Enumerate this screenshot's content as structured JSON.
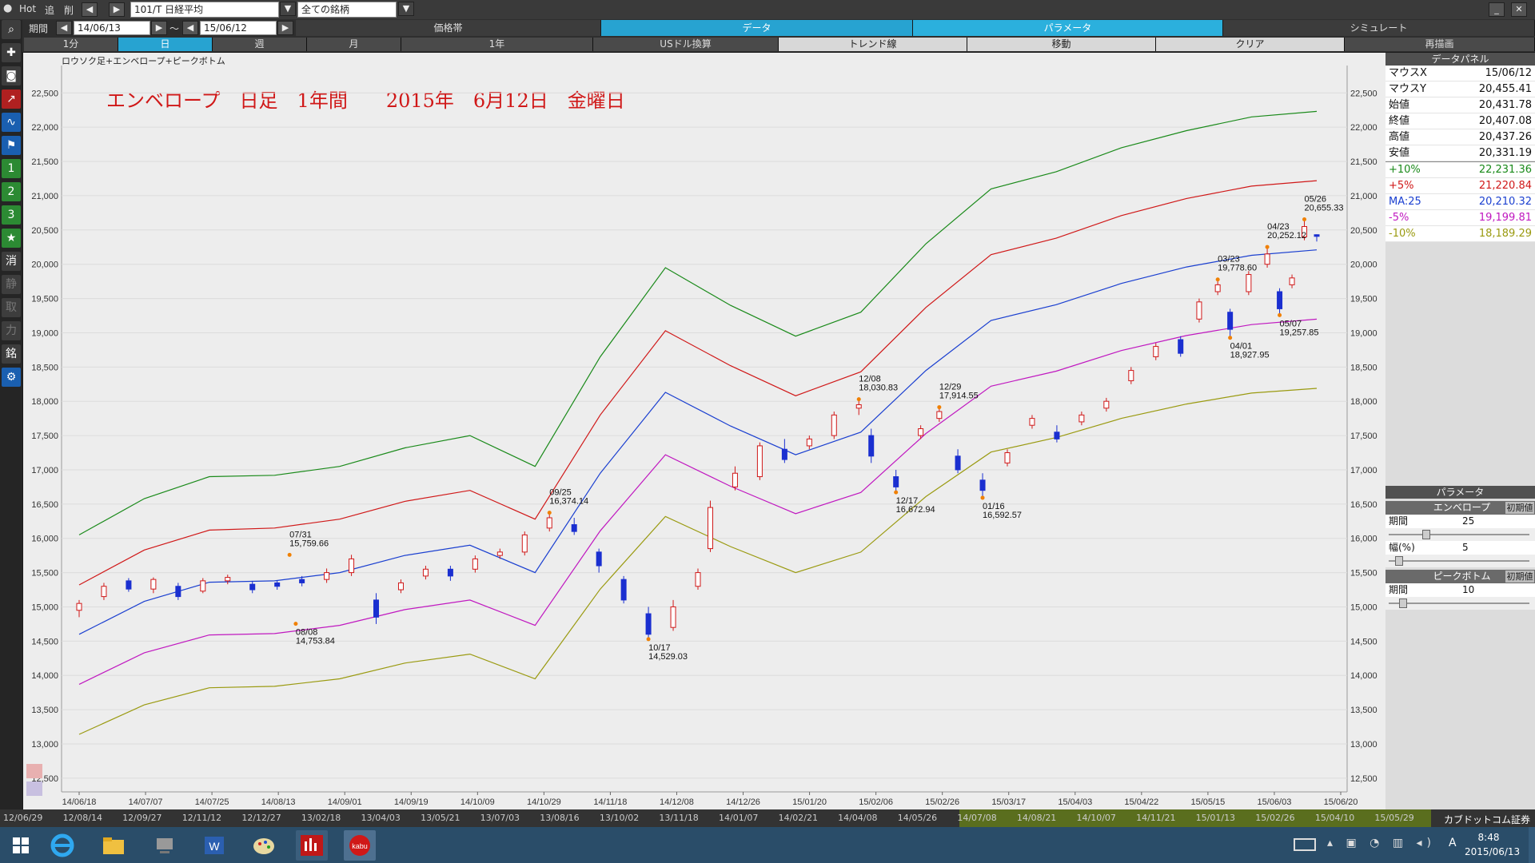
{
  "toolbar": {
    "hot": "Hot",
    "add": "追",
    "del": "削",
    "symbol": "101/T 日経平均",
    "market": "全ての銘柄",
    "period_label": "期間",
    "date_from": "14/06/13",
    "tilde": "～",
    "date_to": "15/06/12",
    "tabs": [
      "価格帯",
      "データ",
      "パラメータ",
      "シミュレート"
    ],
    "active_tab": "データ",
    "buttons": [
      "1分",
      "日",
      "週",
      "月",
      "1年",
      "USドル換算",
      "トレンド線",
      "移動",
      "クリア",
      "再描画"
    ],
    "active_button": "日"
  },
  "sidebar": {
    "items": [
      "search-icon",
      "plus-icon",
      "camera-icon",
      "chart-red-icon",
      "chart-blue-icon",
      "flag-icon",
      "1",
      "2",
      "3",
      "★",
      "消",
      "静",
      "取",
      "力",
      "銘",
      "gear-icon"
    ]
  },
  "chart": {
    "indicator_label": "ロウソク足+エンベロープ+ピークボトム",
    "title": "エンベロープ　日足　1年間　　2015年　6月12日　金曜日",
    "y_ticks": [
      "22,500",
      "22,000",
      "21,500",
      "21,000",
      "20,500",
      "20,000",
      "19,500",
      "19,000",
      "18,500",
      "18,000",
      "17,500",
      "17,000",
      "16,500",
      "16,000",
      "15,500",
      "15,000",
      "14,500",
      "14,000",
      "13,500",
      "13,000",
      "12,500"
    ],
    "x_ticks": [
      "14/06/18",
      "14/07/07",
      "14/07/25",
      "14/08/13",
      "14/09/01",
      "14/09/19",
      "14/10/09",
      "14/10/29",
      "14/11/18",
      "14/12/08",
      "14/12/26",
      "15/01/20",
      "15/02/06",
      "15/02/26",
      "15/03/17",
      "15/04/03",
      "15/04/22",
      "15/05/15",
      "15/06/03",
      "15/06/20"
    ],
    "annotations": [
      {
        "date": "07/31",
        "value": "15,759.66"
      },
      {
        "date": "08/08",
        "value": "14,753.84"
      },
      {
        "date": "09/25",
        "value": "16,374.14"
      },
      {
        "date": "10/17",
        "value": "14,529.03"
      },
      {
        "date": "12/08",
        "value": "18,030.83"
      },
      {
        "date": "12/17",
        "value": "16,672.94"
      },
      {
        "date": "12/29",
        "value": "17,914.55"
      },
      {
        "date": "01/16",
        "value": "16,592.57"
      },
      {
        "date": "03/23",
        "value": "19,778.60"
      },
      {
        "date": "04/01",
        "value": "18,927.95"
      },
      {
        "date": "04/23",
        "value": "20,252.12"
      },
      {
        "date": "05/07",
        "value": "19,257.85"
      },
      {
        "date": "05/26",
        "value": "20,655.33"
      }
    ]
  },
  "data_panel": {
    "title": "データパネル",
    "rows": [
      {
        "label": "マウスX",
        "value": "15/06/12",
        "color": "#111111"
      },
      {
        "label": "マウスY",
        "value": "20,455.41",
        "color": "#111111"
      },
      {
        "label": "始値",
        "value": "20,431.78",
        "color": "#111111"
      },
      {
        "label": "終値",
        "value": "20,407.08",
        "color": "#111111"
      },
      {
        "label": "高値",
        "value": "20,437.26",
        "color": "#111111"
      },
      {
        "label": "安値",
        "value": "20,331.19",
        "color": "#111111"
      },
      {
        "label": "+10%",
        "value": "22,231.36",
        "color": "#1a8a1a"
      },
      {
        "label": "+5%",
        "value": "21,220.84",
        "color": "#d01818"
      },
      {
        "label": "MA:25",
        "value": "20,210.32",
        "color": "#1a3fd0"
      },
      {
        "label": "-5%",
        "value": "19,199.81",
        "color": "#c018c0"
      },
      {
        "label": "-10%",
        "value": "18,189.29",
        "color": "#9a9a10"
      }
    ]
  },
  "parameters": {
    "title": "パラメータ",
    "envelope_label": "エンベロープ",
    "init_label": "初期値",
    "period_label": "期間",
    "period_value": "25",
    "width_label": "幅(%)",
    "width_value": "5",
    "peak_label": "ピークボトム",
    "peak_period_label": "期間",
    "peak_period_value": "10",
    "envelope_period_level": 0.25,
    "envelope_width_level": 0.05,
    "peak_period_level": 0.08
  },
  "timeline": {
    "labels": [
      "12/06/29",
      "12/08/14",
      "12/09/27",
      "12/11/12",
      "12/12/27",
      "13/02/18",
      "13/04/03",
      "13/05/21",
      "13/07/03",
      "13/08/16",
      "13/10/02",
      "13/11/18",
      "14/01/07",
      "14/02/21",
      "14/04/08",
      "14/05/26",
      "14/07/08",
      "14/08/21",
      "14/10/07",
      "14/11/21",
      "15/01/13",
      "15/02/26",
      "15/04/10",
      "15/05/29"
    ],
    "selected_start": 0.625,
    "selected_end": 1.0,
    "brand": "カブドットコム証券"
  },
  "taskbar": {
    "time": "8:48",
    "date": "2015/06/13",
    "ime": "A",
    "apps": [
      "windows-start-icon",
      "ie-icon",
      "explorer-icon",
      "network-icon",
      "word-icon",
      "paint-icon",
      "kabu-chart-icon",
      "kabucom-icon"
    ]
  },
  "chart_data": {
    "type": "line",
    "title": "エンベロープ　日足　1年間　　2015年　6月12日　金曜日",
    "x": [
      "14/06/13",
      "14/07/07",
      "14/07/25",
      "14/08/13",
      "14/09/01",
      "14/09/19",
      "14/10/09",
      "14/10/29",
      "14/11/18",
      "14/12/08",
      "14/12/26",
      "15/01/20",
      "15/02/06",
      "15/02/26",
      "15/03/17",
      "15/04/03",
      "15/04/22",
      "15/05/15",
      "15/06/03",
      "15/06/12"
    ],
    "ylim": [
      12300,
      22900
    ],
    "series": [
      {
        "name": "+10%",
        "color": "#1a8a1a",
        "values": [
          16050,
          16580,
          16900,
          16920,
          17050,
          17320,
          17500,
          17050,
          18650,
          19950,
          19400,
          18950,
          19300,
          20300,
          21100,
          21350,
          21700,
          21950,
          22150,
          22231
        ]
      },
      {
        "name": "+5%",
        "color": "#d01818",
        "values": [
          15320,
          15830,
          16120,
          16150,
          16280,
          16540,
          16700,
          16280,
          17800,
          19030,
          18520,
          18080,
          18430,
          19370,
          20140,
          20380,
          20710,
          20960,
          21140,
          21220
        ]
      },
      {
        "name": "MA:25",
        "color": "#1a3fd0",
        "values": [
          14600,
          15080,
          15360,
          15380,
          15500,
          15750,
          15900,
          15500,
          16950,
          18130,
          17640,
          17220,
          17550,
          18450,
          19180,
          19410,
          19720,
          19960,
          20130,
          20210
        ]
      },
      {
        "name": "-5%",
        "color": "#c018c0",
        "values": [
          13870,
          14330,
          14590,
          14610,
          14730,
          14960,
          15100,
          14730,
          16110,
          17220,
          16760,
          16360,
          16670,
          17530,
          18220,
          18440,
          18740,
          18960,
          19120,
          19199
        ]
      },
      {
        "name": "-10%",
        "color": "#9a9a10",
        "values": [
          13140,
          13570,
          13820,
          13840,
          13950,
          14180,
          14310,
          13950,
          15260,
          16320,
          15880,
          15500,
          15800,
          16610,
          17260,
          17470,
          17750,
          17960,
          18120,
          18189
        ]
      }
    ],
    "candles": [
      {
        "x": 0.0,
        "o": 14950,
        "c": 15050,
        "h": 15100,
        "l": 14850,
        "up": true
      },
      {
        "x": 0.02,
        "o": 15150,
        "c": 15300,
        "h": 15350,
        "l": 15100,
        "up": true
      },
      {
        "x": 0.04,
        "o": 15380,
        "c": 15260,
        "h": 15420,
        "l": 15220,
        "up": false
      },
      {
        "x": 0.06,
        "o": 15260,
        "c": 15400,
        "h": 15430,
        "l": 15200,
        "up": true
      },
      {
        "x": 0.08,
        "o": 15300,
        "c": 15150,
        "h": 15350,
        "l": 15100,
        "up": false
      },
      {
        "x": 0.1,
        "o": 15230,
        "c": 15380,
        "h": 15420,
        "l": 15200,
        "up": true
      },
      {
        "x": 0.12,
        "o": 15380,
        "c": 15430,
        "h": 15470,
        "l": 15330,
        "up": true
      },
      {
        "x": 0.14,
        "o": 15330,
        "c": 15250,
        "h": 15380,
        "l": 15200,
        "up": false
      },
      {
        "x": 0.16,
        "o": 15350,
        "c": 15300,
        "h": 15380,
        "l": 15250,
        "up": false
      },
      {
        "x": 0.18,
        "o": 15400,
        "c": 15350,
        "h": 15450,
        "l": 15300,
        "up": false
      },
      {
        "x": 0.2,
        "o": 15400,
        "c": 15500,
        "h": 15560,
        "l": 15350,
        "up": true
      },
      {
        "x": 0.22,
        "o": 15500,
        "c": 15700,
        "h": 15760,
        "l": 15450,
        "up": true
      },
      {
        "x": 0.24,
        "o": 15100,
        "c": 14850,
        "h": 15200,
        "l": 14750,
        "up": false
      },
      {
        "x": 0.26,
        "o": 15250,
        "c": 15350,
        "h": 15400,
        "l": 15200,
        "up": true
      },
      {
        "x": 0.28,
        "o": 15450,
        "c": 15550,
        "h": 15600,
        "l": 15400,
        "up": true
      },
      {
        "x": 0.3,
        "o": 15550,
        "c": 15450,
        "h": 15600,
        "l": 15380,
        "up": false
      },
      {
        "x": 0.32,
        "o": 15550,
        "c": 15700,
        "h": 15750,
        "l": 15500,
        "up": true
      },
      {
        "x": 0.34,
        "o": 15750,
        "c": 15800,
        "h": 15850,
        "l": 15700,
        "up": true
      },
      {
        "x": 0.36,
        "o": 15800,
        "c": 16050,
        "h": 16100,
        "l": 15750,
        "up": true
      },
      {
        "x": 0.38,
        "o": 16150,
        "c": 16300,
        "h": 16374,
        "l": 16100,
        "up": true
      },
      {
        "x": 0.4,
        "o": 16200,
        "c": 16100,
        "h": 16300,
        "l": 16050,
        "up": false
      },
      {
        "x": 0.42,
        "o": 15800,
        "c": 15600,
        "h": 15850,
        "l": 15500,
        "up": false
      },
      {
        "x": 0.44,
        "o": 15400,
        "c": 15100,
        "h": 15450,
        "l": 15050,
        "up": false
      },
      {
        "x": 0.46,
        "o": 14900,
        "c": 14600,
        "h": 15000,
        "l": 14529,
        "up": false
      },
      {
        "x": 0.48,
        "o": 14700,
        "c": 15000,
        "h": 15100,
        "l": 14650,
        "up": true
      },
      {
        "x": 0.5,
        "o": 15300,
        "c": 15500,
        "h": 15560,
        "l": 15250,
        "up": true
      },
      {
        "x": 0.51,
        "o": 15850,
        "c": 16450,
        "h": 16550,
        "l": 15800,
        "up": true
      },
      {
        "x": 0.53,
        "o": 16750,
        "c": 16950,
        "h": 17050,
        "l": 16700,
        "up": true
      },
      {
        "x": 0.55,
        "o": 16900,
        "c": 17350,
        "h": 17400,
        "l": 16850,
        "up": true
      },
      {
        "x": 0.57,
        "o": 17300,
        "c": 17150,
        "h": 17450,
        "l": 17100,
        "up": false
      },
      {
        "x": 0.59,
        "o": 17350,
        "c": 17450,
        "h": 17500,
        "l": 17300,
        "up": true
      },
      {
        "x": 0.61,
        "o": 17500,
        "c": 17800,
        "h": 17850,
        "l": 17450,
        "up": true
      },
      {
        "x": 0.63,
        "o": 17900,
        "c": 17950,
        "h": 18030,
        "l": 17800,
        "up": true
      },
      {
        "x": 0.64,
        "o": 17500,
        "c": 17200,
        "h": 17600,
        "l": 17100,
        "up": false
      },
      {
        "x": 0.66,
        "o": 16900,
        "c": 16750,
        "h": 17000,
        "l": 16672,
        "up": false
      },
      {
        "x": 0.68,
        "o": 17500,
        "c": 17600,
        "h": 17650,
        "l": 17450,
        "up": true
      },
      {
        "x": 0.695,
        "o": 17750,
        "c": 17850,
        "h": 17914,
        "l": 17700,
        "up": true
      },
      {
        "x": 0.71,
        "o": 17200,
        "c": 17000,
        "h": 17300,
        "l": 16950,
        "up": false
      },
      {
        "x": 0.73,
        "o": 16850,
        "c": 16700,
        "h": 16950,
        "l": 16592,
        "up": false
      },
      {
        "x": 0.75,
        "o": 17100,
        "c": 17250,
        "h": 17300,
        "l": 17050,
        "up": true
      },
      {
        "x": 0.77,
        "o": 17650,
        "c": 17750,
        "h": 17800,
        "l": 17600,
        "up": true
      },
      {
        "x": 0.79,
        "o": 17550,
        "c": 17450,
        "h": 17650,
        "l": 17400,
        "up": false
      },
      {
        "x": 0.81,
        "o": 17700,
        "c": 17800,
        "h": 17850,
        "l": 17650,
        "up": true
      },
      {
        "x": 0.83,
        "o": 17900,
        "c": 18000,
        "h": 18050,
        "l": 17850,
        "up": true
      },
      {
        "x": 0.85,
        "o": 18300,
        "c": 18450,
        "h": 18500,
        "l": 18250,
        "up": true
      },
      {
        "x": 0.87,
        "o": 18650,
        "c": 18800,
        "h": 18850,
        "l": 18600,
        "up": true
      },
      {
        "x": 0.89,
        "o": 18900,
        "c": 18700,
        "h": 18950,
        "l": 18650,
        "up": false
      },
      {
        "x": 0.905,
        "o": 19200,
        "c": 19450,
        "h": 19500,
        "l": 19150,
        "up": true
      },
      {
        "x": 0.92,
        "o": 19600,
        "c": 19700,
        "h": 19778,
        "l": 19550,
        "up": true
      },
      {
        "x": 0.93,
        "o": 19300,
        "c": 19050,
        "h": 19350,
        "l": 18927,
        "up": false
      },
      {
        "x": 0.945,
        "o": 19600,
        "c": 19850,
        "h": 19900,
        "l": 19550,
        "up": true
      },
      {
        "x": 0.96,
        "o": 20000,
        "c": 20150,
        "h": 20252,
        "l": 19950,
        "up": true
      },
      {
        "x": 0.97,
        "o": 19600,
        "c": 19350,
        "h": 19650,
        "l": 19257,
        "up": false
      },
      {
        "x": 0.98,
        "o": 19700,
        "c": 19800,
        "h": 19850,
        "l": 19650,
        "up": true
      },
      {
        "x": 0.99,
        "o": 20400,
        "c": 20550,
        "h": 20655,
        "l": 20350,
        "up": true
      },
      {
        "x": 1.0,
        "o": 20431,
        "c": 20407,
        "h": 20437,
        "l": 20331,
        "up": false
      }
    ]
  }
}
